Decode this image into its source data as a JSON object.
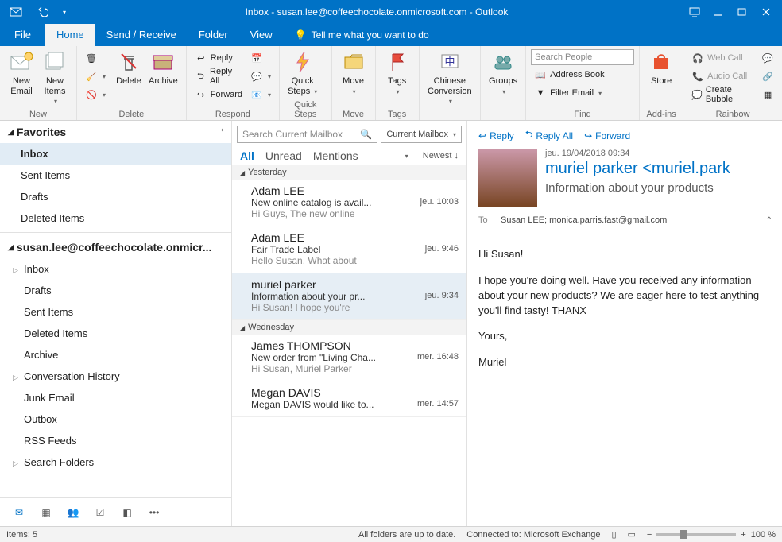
{
  "window": {
    "title": "Inbox - susan.lee@coffeechocolate.onmicrosoft.com  -  Outlook"
  },
  "tabs": {
    "file": "File",
    "home": "Home",
    "sendreceive": "Send / Receive",
    "folder": "Folder",
    "view": "View",
    "tellme": "Tell me what you want to do"
  },
  "ribbon": {
    "new": {
      "label": "New",
      "email": "New\nEmail",
      "items": "New\nItems"
    },
    "delete": {
      "label": "Delete",
      "delete": "Delete",
      "archive": "Archive"
    },
    "respond": {
      "label": "Respond",
      "reply": "Reply",
      "replyall": "Reply All",
      "forward": "Forward"
    },
    "quicksteps": {
      "label": "Quick Steps",
      "btn": "Quick\nSteps"
    },
    "move": {
      "label": "Move",
      "btn": "Move"
    },
    "tags": {
      "label": "Tags",
      "btn": "Tags"
    },
    "chinese": {
      "label": "Chinese\nConversion"
    },
    "groups": {
      "label": "Groups"
    },
    "find": {
      "label": "Find",
      "search_ph": "Search People",
      "addr": "Address Book",
      "filter": "Filter Email"
    },
    "addins": {
      "label": "Add-ins",
      "store": "Store"
    },
    "rainbow": {
      "label": "Rainbow",
      "web": "Web Call",
      "audio": "Audio Call",
      "bubble": "Create Bubble"
    }
  },
  "nav": {
    "favorites": "Favorites",
    "fav_items": [
      "Inbox",
      "Sent Items",
      "Drafts",
      "Deleted Items"
    ],
    "account": "susan.lee@coffeechocolate.onmicr...",
    "folders": [
      "Inbox",
      "Drafts",
      "Sent Items",
      "Deleted Items",
      "Archive",
      "Conversation History",
      "Junk Email",
      "Outbox",
      "RSS Feeds",
      "Search Folders"
    ]
  },
  "msglist": {
    "search_ph": "Search Current Mailbox",
    "scope": "Current Mailbox",
    "filters": {
      "all": "All",
      "unread": "Unread",
      "mentions": "Mentions",
      "newest": "Newest"
    },
    "groups": [
      {
        "label": "Yesterday",
        "items": [
          {
            "from": "Adam LEE",
            "subject": "New online catalog is avail...",
            "preview": "Hi Guys,  The new online",
            "time": "jeu. 10:03"
          },
          {
            "from": "Adam LEE",
            "subject": "Fair Trade Label",
            "preview": "Hello Susan,  What about",
            "time": "jeu. 9:46"
          },
          {
            "from": "muriel parker",
            "subject": "Information about your pr...",
            "preview": "Hi Susan!  I hope you're",
            "time": "jeu. 9:34",
            "selected": true
          }
        ]
      },
      {
        "label": "Wednesday",
        "items": [
          {
            "from": "James THOMPSON",
            "subject": "New order from \"Living Cha...",
            "preview": "Hi Susan,  Muriel Parker",
            "time": "mer. 16:48"
          },
          {
            "from": "Megan DAVIS",
            "subject": "Megan DAVIS would like to...",
            "preview": "",
            "time": "mer. 14:57"
          }
        ]
      }
    ]
  },
  "reading": {
    "actions": {
      "reply": "Reply",
      "replyall": "Reply All",
      "forward": "Forward"
    },
    "date": "jeu. 19/04/2018 09:34",
    "from": "muriel parker <muriel.park",
    "subject": "Information about your products",
    "to_label": "To",
    "to": "Susan LEE; monica.parris.fast@gmail.com",
    "body": {
      "p1": "Hi Susan!",
      "p2": "I hope you're doing well. Have you received any information about your new products? We are eager here to test anything you'll find tasty! THANX",
      "p3": "Yours,",
      "p4": "Muriel"
    }
  },
  "status": {
    "items": "Items: 5",
    "uptodate": "All folders are up to date.",
    "connected": "Connected to: Microsoft Exchange",
    "zoom": "100 %"
  }
}
